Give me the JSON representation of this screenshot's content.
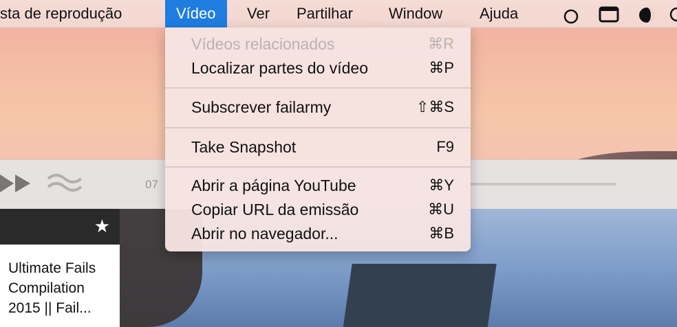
{
  "menubar": {
    "items": [
      {
        "label": "sta de reprodução"
      },
      {
        "label": "Vídeo"
      },
      {
        "label": "Ver"
      },
      {
        "label": "Partilhar"
      },
      {
        "label": "Window"
      },
      {
        "label": "Ajuda"
      }
    ],
    "status_icons": [
      "circle-icon",
      "window-icon",
      "moon-icon"
    ]
  },
  "video_menu": {
    "items": [
      {
        "label": "Vídeos relacionados",
        "shortcut": "⌘R",
        "enabled": false
      },
      {
        "label": "Localizar partes do vídeo",
        "shortcut": "⌘P",
        "enabled": true
      },
      {
        "label": "Subscrever failarmy",
        "shortcut": "⇧⌘S",
        "enabled": true
      },
      {
        "label": "Take Snapshot",
        "shortcut": "F9",
        "enabled": true
      },
      {
        "label": "Abrir a página YouTube",
        "shortcut": "⌘Y",
        "enabled": true
      },
      {
        "label": "Copiar URL da emissão",
        "shortcut": "⌘U",
        "enabled": true
      },
      {
        "label": "Abrir no navegador...",
        "shortcut": "⌘B",
        "enabled": true
      }
    ]
  },
  "player": {
    "time": "07"
  },
  "sidebar": {
    "card_title": "Ultimate Fails Compilation 2015 || Fail..."
  },
  "colors": {
    "accent": "#1f7de0",
    "menu_bg": "#f6e4e2",
    "disabled_text": "#b9b2b1"
  }
}
